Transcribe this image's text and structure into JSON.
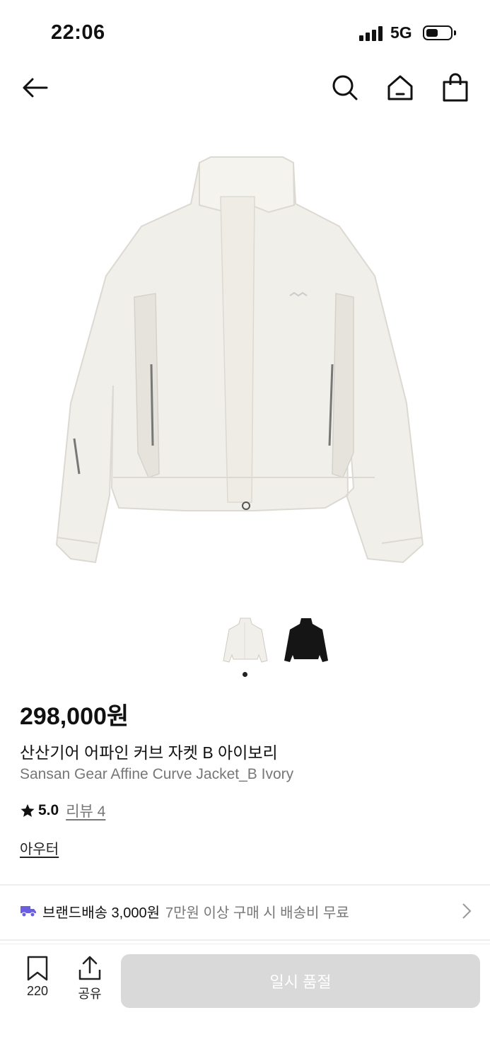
{
  "status_bar": {
    "time": "22:06",
    "network": "5G",
    "battery_level": 0.45
  },
  "product": {
    "price": "298,000원",
    "name_ko": "산산기어 어파인 커브 자켓 B 아이보리",
    "name_en": "Sansan Gear Affine Curve Jacket_B Ivory",
    "rating": "5.0",
    "reviews_label": "리뷰 4",
    "category": "아우터",
    "main_color": "#f1efea"
  },
  "thumbnails": [
    {
      "color": "ivory"
    },
    {
      "color": "black"
    }
  ],
  "delivery": {
    "label": "브랜드배송 3,000원",
    "condition": "7만원 이상 구매 시 배송비 무료"
  },
  "bottom_bar": {
    "wishlist_count": "220",
    "share_label": "공유",
    "cta_label": "일시 품절"
  },
  "colors": {
    "accent": "#6b5fe0",
    "disabled_button": "#d9d9d9"
  }
}
